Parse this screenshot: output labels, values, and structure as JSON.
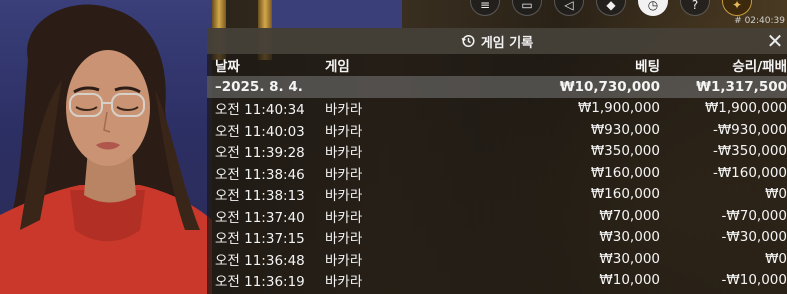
{
  "session_id": "# 02:40:39",
  "controls": [
    {
      "icon": "menu-icon",
      "glyph": "≡"
    },
    {
      "icon": "chat-icon",
      "glyph": "▭"
    },
    {
      "icon": "sound-icon",
      "glyph": "◁"
    },
    {
      "icon": "settings-icon",
      "glyph": "◆"
    },
    {
      "icon": "history-icon",
      "glyph": "◷"
    },
    {
      "icon": "help-icon",
      "glyph": "?"
    },
    {
      "icon": "fullscreen-icon",
      "glyph": "✦"
    }
  ],
  "panel": {
    "title": "게임 기록",
    "close_glyph": "✕"
  },
  "table": {
    "headers": {
      "date": "날짜",
      "game": "게임",
      "bet": "베팅",
      "result": "승리/패배"
    },
    "date_group": {
      "date": "–2025. 8. 4.",
      "bet": "₩10,730,000",
      "result": "₩1,317,500"
    },
    "rows": [
      {
        "date": "오전 11:40:34",
        "game": "바카라",
        "bet": "₩1,900,000",
        "result": "₩1,900,000"
      },
      {
        "date": "오전 11:40:03",
        "game": "바카라",
        "bet": "₩930,000",
        "result": "-₩930,000"
      },
      {
        "date": "오전 11:39:28",
        "game": "바카라",
        "bet": "₩350,000",
        "result": "-₩350,000"
      },
      {
        "date": "오전 11:38:46",
        "game": "바카라",
        "bet": "₩160,000",
        "result": "-₩160,000"
      },
      {
        "date": "오전 11:38:13",
        "game": "바카라",
        "bet": "₩160,000",
        "result": "₩0"
      },
      {
        "date": "오전 11:37:40",
        "game": "바카라",
        "bet": "₩70,000",
        "result": "-₩70,000"
      },
      {
        "date": "오전 11:37:15",
        "game": "바카라",
        "bet": "₩30,000",
        "result": "-₩30,000"
      },
      {
        "date": "오전 11:36:48",
        "game": "바카라",
        "bet": "₩30,000",
        "result": "₩0"
      },
      {
        "date": "오전 11:36:19",
        "game": "바카라",
        "bet": "₩10,000",
        "result": "-₩10,000"
      }
    ]
  }
}
